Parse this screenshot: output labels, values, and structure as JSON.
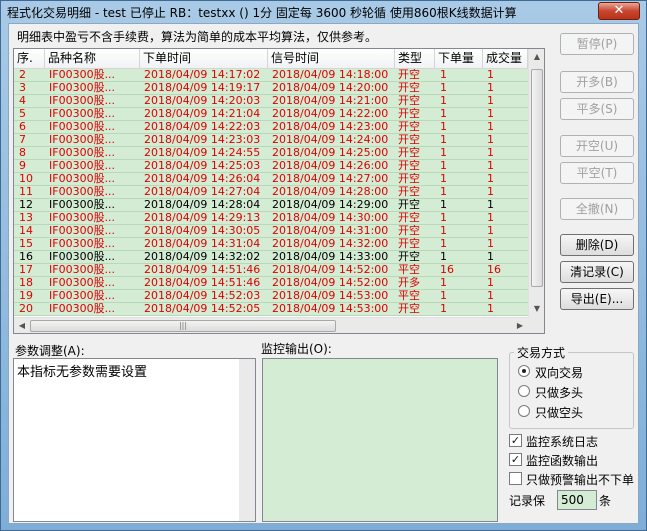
{
  "window": {
    "title": "程式化交易明细 - test 已停止  RB：testxx () 1分 固定每 3600 秒轮循 使用860根K线数据计算",
    "close_label": "✕"
  },
  "description": "明细表中盈亏不含手续费，算法为简单的成本平均算法，仅供参考。",
  "table": {
    "columns": [
      "序.",
      "品种名称",
      "下单时间",
      "信号时间",
      "类型",
      "下单量",
      "成交量"
    ],
    "rows": [
      {
        "no": "2",
        "name": "IF00300股...",
        "order_time": "2018/04/09  14:17:02",
        "signal_time": "2018/04/09  14:18:00",
        "type": "开空",
        "qty": "1",
        "filled": "1",
        "color": "red"
      },
      {
        "no": "3",
        "name": "IF00300股...",
        "order_time": "2018/04/09  14:19:17",
        "signal_time": "2018/04/09  14:20:00",
        "type": "开空",
        "qty": "1",
        "filled": "1",
        "color": "red"
      },
      {
        "no": "4",
        "name": "IF00300股...",
        "order_time": "2018/04/09  14:20:03",
        "signal_time": "2018/04/09  14:21:00",
        "type": "开空",
        "qty": "1",
        "filled": "1",
        "color": "red"
      },
      {
        "no": "5",
        "name": "IF00300股...",
        "order_time": "2018/04/09  14:21:04",
        "signal_time": "2018/04/09  14:22:00",
        "type": "开空",
        "qty": "1",
        "filled": "1",
        "color": "red"
      },
      {
        "no": "6",
        "name": "IF00300股...",
        "order_time": "2018/04/09  14:22:03",
        "signal_time": "2018/04/09  14:23:00",
        "type": "开空",
        "qty": "1",
        "filled": "1",
        "color": "red"
      },
      {
        "no": "7",
        "name": "IF00300股...",
        "order_time": "2018/04/09  14:23:03",
        "signal_time": "2018/04/09  14:24:00",
        "type": "开空",
        "qty": "1",
        "filled": "1",
        "color": "red"
      },
      {
        "no": "8",
        "name": "IF00300股...",
        "order_time": "2018/04/09  14:24:55",
        "signal_time": "2018/04/09  14:25:00",
        "type": "开空",
        "qty": "1",
        "filled": "1",
        "color": "red"
      },
      {
        "no": "9",
        "name": "IF00300股...",
        "order_time": "2018/04/09  14:25:03",
        "signal_time": "2018/04/09  14:26:00",
        "type": "开空",
        "qty": "1",
        "filled": "1",
        "color": "red"
      },
      {
        "no": "10",
        "name": "IF00300股...",
        "order_time": "2018/04/09  14:26:04",
        "signal_time": "2018/04/09  14:27:00",
        "type": "开空",
        "qty": "1",
        "filled": "1",
        "color": "red"
      },
      {
        "no": "11",
        "name": "IF00300股...",
        "order_time": "2018/04/09  14:27:04",
        "signal_time": "2018/04/09  14:28:00",
        "type": "开空",
        "qty": "1",
        "filled": "1",
        "color": "red"
      },
      {
        "no": "12",
        "name": "IF00300股...",
        "order_time": "2018/04/09  14:28:04",
        "signal_time": "2018/04/09  14:29:00",
        "type": "开空",
        "qty": "1",
        "filled": "1",
        "color": "black"
      },
      {
        "no": "13",
        "name": "IF00300股...",
        "order_time": "2018/04/09  14:29:13",
        "signal_time": "2018/04/09  14:30:00",
        "type": "开空",
        "qty": "1",
        "filled": "1",
        "color": "red"
      },
      {
        "no": "14",
        "name": "IF00300股...",
        "order_time": "2018/04/09  14:30:05",
        "signal_time": "2018/04/09  14:31:00",
        "type": "开空",
        "qty": "1",
        "filled": "1",
        "color": "red"
      },
      {
        "no": "15",
        "name": "IF00300股...",
        "order_time": "2018/04/09  14:31:04",
        "signal_time": "2018/04/09  14:32:00",
        "type": "开空",
        "qty": "1",
        "filled": "1",
        "color": "red"
      },
      {
        "no": "16",
        "name": "IF00300股...",
        "order_time": "2018/04/09  14:32:02",
        "signal_time": "2018/04/09  14:33:00",
        "type": "开空",
        "qty": "1",
        "filled": "1",
        "color": "black"
      },
      {
        "no": "17",
        "name": "IF00300股...",
        "order_time": "2018/04/09  14:51:46",
        "signal_time": "2018/04/09  14:52:00",
        "type": "平空",
        "qty": "16",
        "filled": "16",
        "color": "red"
      },
      {
        "no": "18",
        "name": "IF00300股...",
        "order_time": "2018/04/09  14:51:46",
        "signal_time": "2018/04/09  14:52:00",
        "type": "开多",
        "qty": "1",
        "filled": "1",
        "color": "red"
      },
      {
        "no": "19",
        "name": "IF00300股...",
        "order_time": "2018/04/09  14:52:03",
        "signal_time": "2018/04/09  14:53:00",
        "type": "平空",
        "qty": "1",
        "filled": "1",
        "color": "red"
      },
      {
        "no": "20",
        "name": "IF00300股...",
        "order_time": "2018/04/09  14:52:05",
        "signal_time": "2018/04/09  14:53:00",
        "type": "开空",
        "qty": "1",
        "filled": "1",
        "color": "red"
      }
    ],
    "hscroll_grip": "|||"
  },
  "buttons": {
    "pause": "暂停(P)",
    "open_long": "开多(B)",
    "close_long": "平多(S)",
    "open_short": "开空(U)",
    "close_short": "平空(T)",
    "close_all": "全撤(N)",
    "delete": "删除(D)",
    "clear_records": "清记录(C)",
    "export": "导出(E)..."
  },
  "params": {
    "label": "参数调整(A):",
    "text": "本指标无参数需要设置"
  },
  "monitor": {
    "label": "监控输出(O):"
  },
  "trade_mode": {
    "title": "交易方式",
    "options": [
      "双向交易",
      "只做多头",
      "只做空头"
    ],
    "selected": 0
  },
  "options": {
    "monitor_log": {
      "label": "监控系统日志",
      "checked": true
    },
    "monitor_func": {
      "label": "监控函数输出",
      "checked": true
    },
    "warn_only": {
      "label": "只做预警输出不下单",
      "checked": false
    }
  },
  "record_keep": {
    "label": "记录保",
    "value": "500",
    "unit": "条"
  }
}
